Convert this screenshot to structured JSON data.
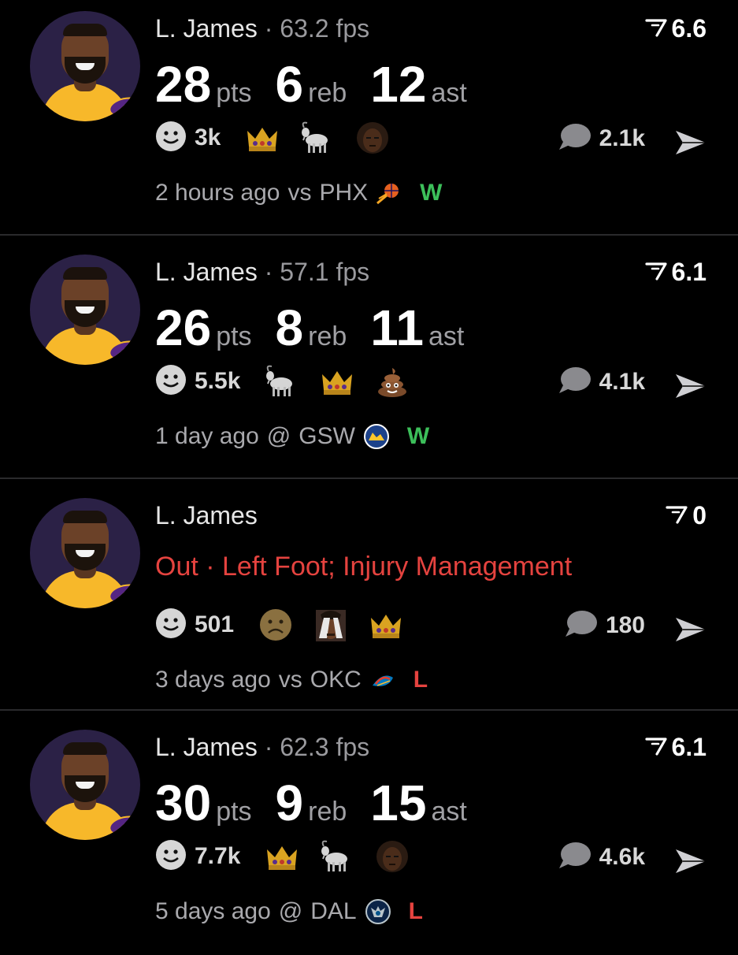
{
  "colors": {
    "win": "#3cbf5a",
    "loss": "#e5433f",
    "injury": "#e5433f"
  },
  "games": [
    {
      "player": "L. James",
      "separator": " · ",
      "fps": "63.2 fps",
      "rating": "6.6",
      "pts": "28",
      "pts_label": "pts",
      "reb": "6",
      "reb_label": "reb",
      "ast": "12",
      "ast_label": "ast",
      "reaction_count": "3k",
      "emojis": [
        "crown-emoji",
        "goat-emoji",
        "player-face-emoji"
      ],
      "comments": "2.1k",
      "time": "2 hours ago",
      "venue": "vs",
      "opponent": "PHX",
      "opponent_logo": "suns-logo",
      "result": "W"
    },
    {
      "player": "L. James",
      "separator": " · ",
      "fps": "57.1 fps",
      "rating": "6.1",
      "pts": "26",
      "pts_label": "pts",
      "reb": "8",
      "reb_label": "reb",
      "ast": "11",
      "ast_label": "ast",
      "reaction_count": "5.5k",
      "emojis": [
        "goat-emoji",
        "crown-emoji",
        "poop-emoji"
      ],
      "comments": "4.1k",
      "time": "1 day ago",
      "venue": "@",
      "opponent": "GSW",
      "opponent_logo": "warriors-logo",
      "result": "W"
    },
    {
      "player": "L. James",
      "status": "Out · Left Foot; Injury Management",
      "rating": "0",
      "reaction_count": "501",
      "emojis": [
        "frowning-face-emoji",
        "facepalm-man-emoji",
        "crown-emoji"
      ],
      "comments": "180",
      "time": "3 days ago",
      "venue": "vs",
      "opponent": "OKC",
      "opponent_logo": "thunder-logo",
      "result": "L"
    },
    {
      "player": "L. James",
      "separator": " · ",
      "fps": "62.3 fps",
      "rating": "6.1",
      "pts": "30",
      "pts_label": "pts",
      "reb": "9",
      "reb_label": "reb",
      "ast": "15",
      "ast_label": "ast",
      "reaction_count": "7.7k",
      "emojis": [
        "crown-emoji",
        "goat-emoji",
        "player-face-emoji"
      ],
      "comments": "4.6k",
      "time": "5 days ago",
      "venue": "@",
      "opponent": "DAL",
      "opponent_logo": "mavericks-logo",
      "result": "L"
    }
  ]
}
